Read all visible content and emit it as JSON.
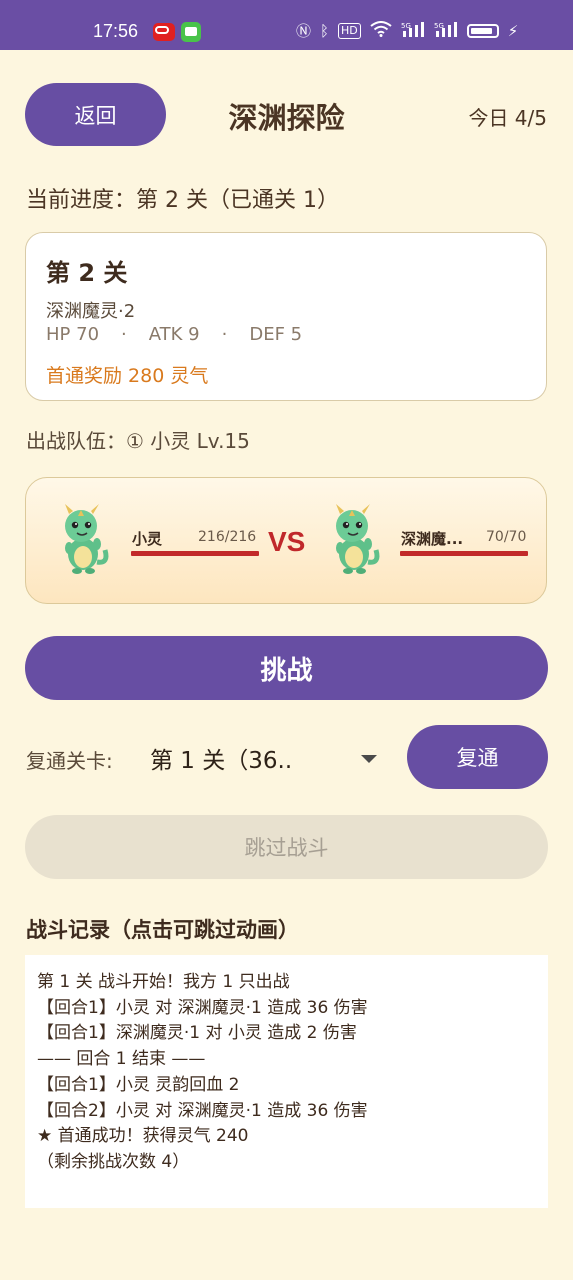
{
  "status_bar": {
    "time": "17:56",
    "icons": [
      "nfc-icon",
      "bluetooth-icon",
      "hd-icon",
      "wifi-icon",
      "signal-5g-icon",
      "signal-5g-icon",
      "battery-icon",
      "charging-icon"
    ],
    "hd_label": "HD",
    "net1": "5G",
    "net2": "5G"
  },
  "header": {
    "back_label": "返回",
    "title": "深渊探险",
    "today_count": "今日 4/5"
  },
  "progress_text": "当前进度：第 2 关（已通关 1）",
  "stage": {
    "name": "第 2 关",
    "enemy": "深渊魔灵·2",
    "hp": "HP 70",
    "atk": "ATK 9",
    "def": "DEF 5",
    "sep": "·",
    "reward": "首通奖励  280 灵气"
  },
  "team_text": "出战队伍：① 小灵 Lv.15",
  "battle": {
    "player": {
      "name": "小灵",
      "hp": "216/216",
      "hp_fraction": 1.0
    },
    "vs": "VS",
    "enemy": {
      "name": "深渊魔...",
      "hp": "70/70",
      "hp_fraction": 1.0
    }
  },
  "challenge_label": "挑战",
  "replay": {
    "label": "复通关卡:",
    "selected": "第 1 关（36..",
    "button": "复通"
  },
  "skip_label": "跳过战斗",
  "log": {
    "title": "战斗记录（点击可跳过动画）",
    "lines": [
      "第 1 关 战斗开始！我方 1 只出战",
      "【回合1】小灵 对 深渊魔灵·1 造成 36 伤害",
      "【回合1】深渊魔灵·1 对 小灵 造成 2 伤害",
      "—— 回合 1 结束 ——",
      "【回合1】小灵 灵韵回血 2",
      "【回合2】小灵 对 深渊魔灵·1 造成 36 伤害",
      "★ 首通成功！获得灵气 240",
      "（剩余挑战次数 4）"
    ]
  },
  "colors": {
    "background": "#fdf6df",
    "primary": "#674ea3",
    "hp_bar": "#c22a2a",
    "vs": "#c0282b",
    "reward": "#d97a1e",
    "disabled": "#e8e1cf"
  }
}
